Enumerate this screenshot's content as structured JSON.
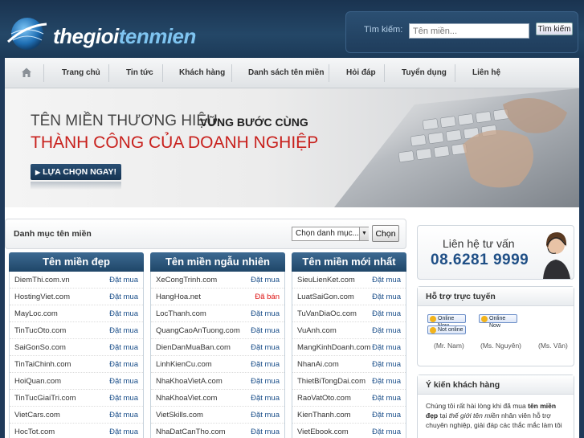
{
  "header": {
    "logo_prefix": "thegioi",
    "logo_accent": "tenmien",
    "search_label": "Tìm kiếm:",
    "search_placeholder": "Tên miền...",
    "search_button": "Tìm kiếm"
  },
  "nav": {
    "items": [
      "Trang chủ",
      "Tin tức",
      "Khách hàng",
      "Danh sách tên miền",
      "Hỏi đáp",
      "Tuyển dụng",
      "Liên hệ"
    ]
  },
  "banner": {
    "line1": "TÊN MIỀN THƯƠNG HIỆU",
    "line1_bold": "VỮNG BƯỚC CÙNG",
    "line2": "THÀNH CÔNG CỦA DOANH NGHIỆP",
    "cta": "LỰA CHỌN NGAY!"
  },
  "category": {
    "title": "Danh mục tên miền",
    "select_value": "Chọn danh mục...",
    "button": "Chọn"
  },
  "columns": [
    {
      "title": "Tên miền đẹp",
      "rows": [
        {
          "name": "DiemThi.com.vn",
          "action": "Đặt mua"
        },
        {
          "name": "HostingViet.com",
          "action": "Đặt mua"
        },
        {
          "name": "MayLoc.com",
          "action": "Đặt mua"
        },
        {
          "name": "TinTucOto.com",
          "action": "Đặt mua"
        },
        {
          "name": "SaiGonSo.com",
          "action": "Đặt mua"
        },
        {
          "name": "TinTaiChinh.com",
          "action": "Đặt mua"
        },
        {
          "name": "HoiQuan.com",
          "action": "Đặt mua"
        },
        {
          "name": "TinTucGiaiTri.com",
          "action": "Đặt mua"
        },
        {
          "name": "VietCars.com",
          "action": "Đặt mua"
        },
        {
          "name": "HocTot.com",
          "action": "Đặt mua"
        }
      ]
    },
    {
      "title": "Tên miền ngẫu nhiên",
      "rows": [
        {
          "name": "XeCongTrinh.com",
          "action": "Đặt mua"
        },
        {
          "name": "HangHoa.net",
          "action": "Đã bán"
        },
        {
          "name": "LocThanh.com",
          "action": "Đặt mua"
        },
        {
          "name": "QuangCaoAnTuong.com",
          "action": "Đặt mua"
        },
        {
          "name": "DienDanMuaBan.com",
          "action": "Đặt mua"
        },
        {
          "name": "LinhKienCu.com",
          "action": "Đặt mua"
        },
        {
          "name": "NhaKhoaVietA.com",
          "action": "Đặt mua"
        },
        {
          "name": "NhaKhoaViet.com",
          "action": "Đặt mua"
        },
        {
          "name": "VietSkills.com",
          "action": "Đặt mua"
        },
        {
          "name": "NhaDatCanTho.com",
          "action": "Đặt mua"
        }
      ]
    },
    {
      "title": "Tên miền mới nhất",
      "rows": [
        {
          "name": "SieuLienKet.com",
          "action": "Đặt mua"
        },
        {
          "name": "LuatSaiGon.com",
          "action": "Đặt mua"
        },
        {
          "name": "TuVanDiaOc.com",
          "action": "Đặt mua"
        },
        {
          "name": "VuAnh.com",
          "action": "Đặt mua"
        },
        {
          "name": "MangKinhDoanh.com",
          "action": "Đặt mua"
        },
        {
          "name": "NhanAi.com",
          "action": "Đặt mua"
        },
        {
          "name": "ThietBiTongDai.com",
          "action": "Đặt mua"
        },
        {
          "name": "RaoVatOto.com",
          "action": "Đặt mua"
        },
        {
          "name": "KienThanh.com",
          "action": "Đặt mua"
        },
        {
          "name": "VietEbook.com",
          "action": "Đặt mua"
        }
      ]
    }
  ],
  "sidebar": {
    "contact_label": "Liên hệ tư vấn",
    "contact_phone": "08.6281 9999",
    "support_title": "Hỗ trợ trực tuyến",
    "status_online": "Online Now",
    "status_offline": "Not online",
    "staff": [
      "(Mr. Nam)",
      "(Ms. Nguyên)",
      "(Ms. Vân)"
    ],
    "opinion_title": "Ý kiến khách hàng",
    "opinion_a": "Chúng tôi rất hài lòng khi đã mua ",
    "opinion_b": "tên miền đẹp",
    "opinion_c": " tại ",
    "opinion_d": "thế giới tên miền",
    "opinion_e": " nhân viên hỗ trợ chuyên nghiệp, giải đáp các thắc mắc làm tôi"
  },
  "colors": {
    "header_bg": "#1f3a5a",
    "column_header": "#2b557b",
    "link": "#1b4f8a",
    "sold": "#dd1111",
    "banner_red": "#c8201c"
  }
}
